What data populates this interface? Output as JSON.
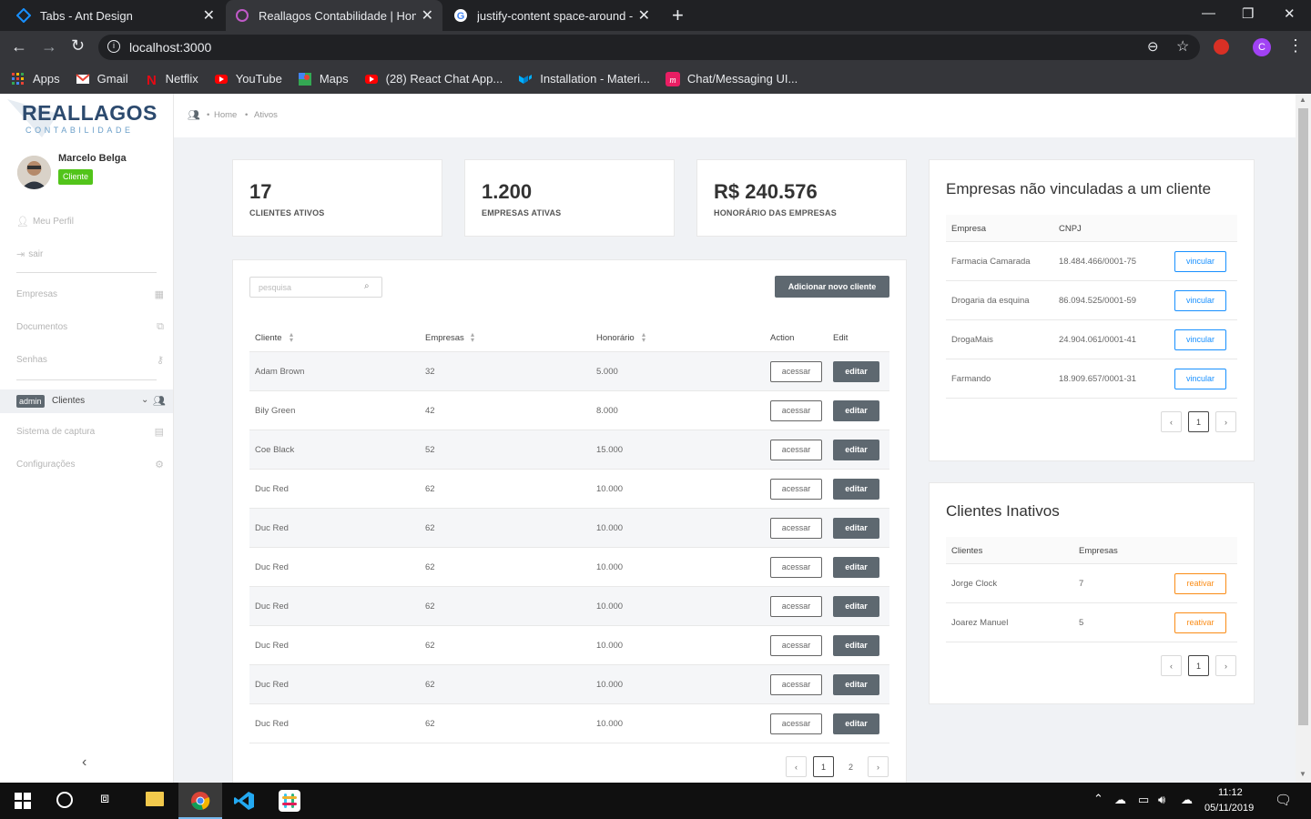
{
  "browser": {
    "tabs": [
      {
        "title": "Tabs - Ant Design",
        "active": false
      },
      {
        "title": "Reallagos Contabilidade | Home",
        "active": true
      },
      {
        "title": "justify-content space-around - Pe",
        "active": false
      }
    ],
    "new_tab": "+",
    "url": "localhost:3000",
    "bookmarks": [
      "Apps",
      "Gmail",
      "Netflix",
      "YouTube",
      "Maps",
      "(28) React Chat App...",
      "Installation - Materi...",
      "Chat/Messaging UI..."
    ],
    "profile_initial": "C"
  },
  "sidebar": {
    "logo_main": "REALLAGOS",
    "logo_sub": "CONTABILIDADE",
    "user_name": "Marcelo Belga",
    "user_badge": "Cliente",
    "profile_link": "Meu Perfil",
    "logout_link": "sair",
    "menu": [
      {
        "label": "Empresas",
        "icon": "building-icon"
      },
      {
        "label": "Documentos",
        "icon": "documents-icon"
      },
      {
        "label": "Senhas",
        "icon": "key-icon"
      }
    ],
    "admin_badge": "admin",
    "admin_item": "Clientes",
    "menu2": [
      {
        "label": "Sistema de captura",
        "icon": "capture-icon"
      },
      {
        "label": "Configurações",
        "icon": "settings-icon"
      }
    ],
    "collapse": "‹"
  },
  "breadcrumb": {
    "items": [
      "Home",
      "Ativos"
    ]
  },
  "stats": [
    {
      "value": "17",
      "label": "CLIENTES ATIVOS"
    },
    {
      "value": "1.200",
      "label": "EMPRESAS ATIVAS"
    },
    {
      "value": "R$ 240.576",
      "label": "HONORÁRIO DAS EMPRESAS"
    }
  ],
  "clients": {
    "search_placeholder": "pesquisa",
    "add_button": "Adicionar novo cliente",
    "columns": [
      "Cliente",
      "Empresas",
      "Honorário",
      "Action",
      "Edit"
    ],
    "access_label": "acessar",
    "edit_label": "editar",
    "rows": [
      {
        "name": "Adam Brown",
        "empresas": "32",
        "honorario": "5.000"
      },
      {
        "name": "Bily Green",
        "empresas": "42",
        "honorario": "8.000"
      },
      {
        "name": "Coe Black",
        "empresas": "52",
        "honorario": "15.000"
      },
      {
        "name": "Duc Red",
        "empresas": "62",
        "honorario": "10.000"
      },
      {
        "name": "Duc Red",
        "empresas": "62",
        "honorario": "10.000"
      },
      {
        "name": "Duc Red",
        "empresas": "62",
        "honorario": "10.000"
      },
      {
        "name": "Duc Red",
        "empresas": "62",
        "honorario": "10.000"
      },
      {
        "name": "Duc Red",
        "empresas": "62",
        "honorario": "10.000"
      },
      {
        "name": "Duc Red",
        "empresas": "62",
        "honorario": "10.000"
      },
      {
        "name": "Duc Red",
        "empresas": "62",
        "honorario": "10.000"
      }
    ],
    "pages": [
      "1",
      "2"
    ],
    "current_page": "1"
  },
  "unlinked": {
    "title": "Empresas não vinculadas a um cliente",
    "columns": [
      "Empresa",
      "CNPJ"
    ],
    "action_label": "vincular",
    "rows": [
      {
        "empresa": "Farmacia Camarada",
        "cnpj": "18.484.466/0001-75"
      },
      {
        "empresa": "Drogaria da esquina",
        "cnpj": "86.094.525/0001-59"
      },
      {
        "empresa": "DrogaMais",
        "cnpj": "24.904.061/0001-41"
      },
      {
        "empresa": "Farmando",
        "cnpj": "18.909.657/0001-31"
      }
    ],
    "page": "1"
  },
  "inactive": {
    "title": "Clientes Inativos",
    "columns": [
      "Clientes",
      "Empresas"
    ],
    "action_label": "reativar",
    "rows": [
      {
        "cliente": "Jorge Clock",
        "empresas": "7"
      },
      {
        "cliente": "Joarez Manuel",
        "empresas": "5"
      }
    ],
    "page": "1"
  },
  "taskbar": {
    "time": "11:12",
    "date": "05/11/2019"
  },
  "colors": {
    "accent": "#1890ff",
    "badge_green": "#52c41a",
    "dark_button": "#5e6870",
    "orange": "#fa8c16"
  }
}
